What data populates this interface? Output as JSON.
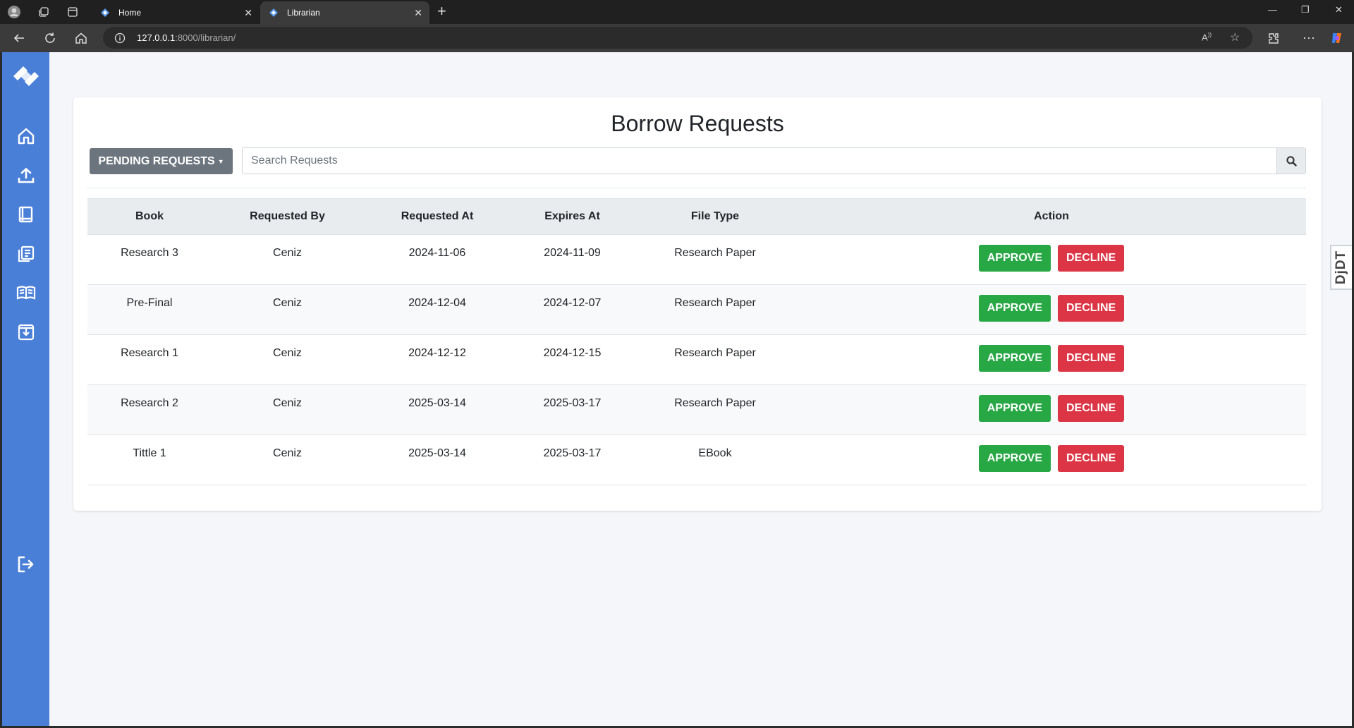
{
  "browser": {
    "tabs": [
      {
        "label": "Home"
      },
      {
        "label": "Librarian"
      }
    ],
    "url": {
      "host": "127.0.0.1",
      "rest": ":8000/librarian/"
    }
  },
  "page": {
    "title": "Borrow Requests",
    "filter_label": "PENDING REQUESTS",
    "search_placeholder": "Search Requests"
  },
  "table": {
    "headers": [
      "Book",
      "Requested By",
      "Requested At",
      "Expires At",
      "File Type",
      "Action"
    ],
    "approve_label": "APPROVE",
    "decline_label": "DECLINE",
    "rows": [
      {
        "book": "Research 3",
        "by": "Ceniz",
        "requested": "2024-11-06",
        "expires": "2024-11-09",
        "type": "Research Paper"
      },
      {
        "book": "Pre-Final",
        "by": "Ceniz",
        "requested": "2024-12-04",
        "expires": "2024-12-07",
        "type": "Research Paper"
      },
      {
        "book": "Research 1",
        "by": "Ceniz",
        "requested": "2024-12-12",
        "expires": "2024-12-15",
        "type": "Research Paper"
      },
      {
        "book": "Research 2",
        "by": "Ceniz",
        "requested": "2025-03-14",
        "expires": "2025-03-17",
        "type": "Research Paper"
      },
      {
        "book": "Tittle 1",
        "by": "Ceniz",
        "requested": "2025-03-14",
        "expires": "2025-03-17",
        "type": "EBook"
      }
    ]
  },
  "debug_toolbar": {
    "label": "DjDT"
  },
  "colors": {
    "sidebar": "#4a7fd8",
    "approve": "#28a745",
    "decline": "#dc3545",
    "filter_button": "#6c757d"
  }
}
